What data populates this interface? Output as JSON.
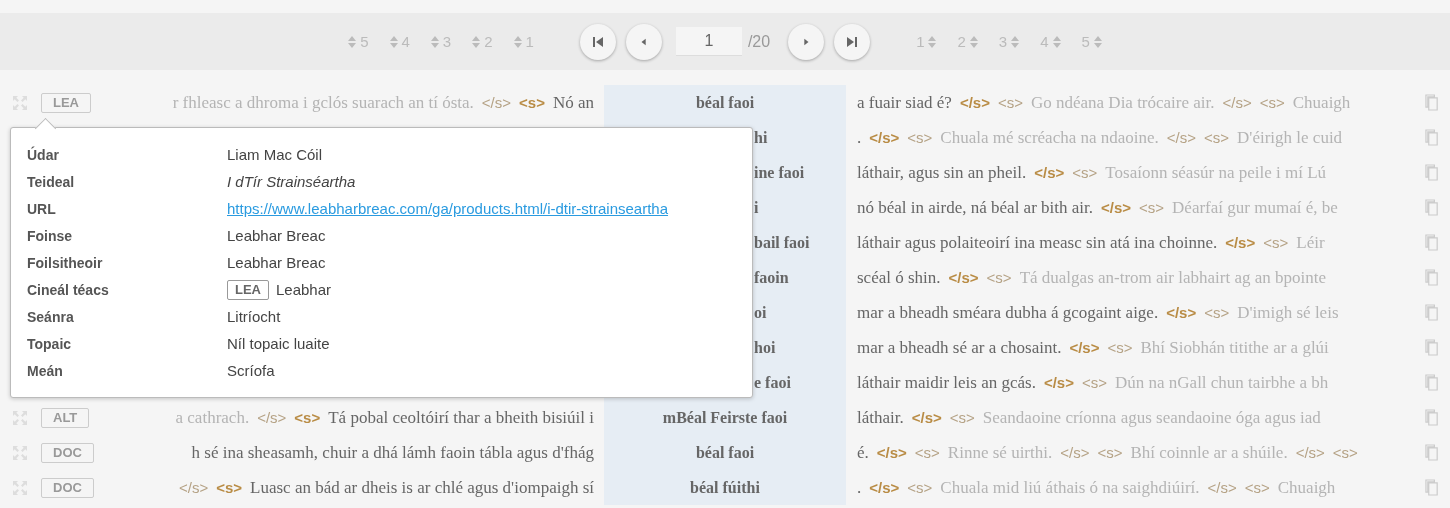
{
  "toolbar": {
    "left_sorts": [
      "5",
      "4",
      "3",
      "2",
      "1"
    ],
    "page_input": "1",
    "page_total": "/20",
    "right_sorts": [
      "1",
      "2",
      "3",
      "4",
      "5"
    ]
  },
  "rows": [
    {
      "badge": "LEA",
      "keyword": "béal faoi",
      "cut_off": false,
      "left": [
        {
          "kind": "text",
          "text": "r fhleasc a dhroma i gclós suarach an tí ósta.",
          "near": false
        },
        {
          "kind": "tag",
          "text": "</s>",
          "near": false
        },
        {
          "kind": "tag",
          "text": "<s>",
          "near": true
        },
        {
          "kind": "text",
          "text": "Nó an",
          "near": true
        }
      ],
      "right": [
        {
          "kind": "text",
          "text": "a fuair siad é?",
          "near": true
        },
        {
          "kind": "tag",
          "text": "</s>",
          "near": true
        },
        {
          "kind": "tag",
          "text": "<s>",
          "near": false
        },
        {
          "kind": "text",
          "text": "Go ndéana Dia trócaire air.",
          "near": false
        },
        {
          "kind": "tag",
          "text": "</s>",
          "near": false
        },
        {
          "kind": "tag",
          "text": "<s>",
          "near": false
        },
        {
          "kind": "text",
          "text": "Chuaigh",
          "near": false
        }
      ]
    },
    {
      "keyword": "hi",
      "cut_off": true,
      "right": [
        {
          "kind": "text",
          "text": ".",
          "near": true
        },
        {
          "kind": "tag",
          "text": "</s>",
          "near": true
        },
        {
          "kind": "tag",
          "text": "<s>",
          "near": false
        },
        {
          "kind": "text",
          "text": "Chuala mé scréacha na ndaoine.",
          "near": false
        },
        {
          "kind": "tag",
          "text": "</s>",
          "near": false
        },
        {
          "kind": "tag",
          "text": "<s>",
          "near": false
        },
        {
          "kind": "text",
          "text": "D'éirigh le cuid",
          "near": false
        }
      ]
    },
    {
      "keyword": "ine faoi",
      "cut_off": true,
      "right": [
        {
          "kind": "text",
          "text": "láthair, agus sin an pheil.",
          "near": true
        },
        {
          "kind": "tag",
          "text": "</s>",
          "near": true
        },
        {
          "kind": "tag",
          "text": "<s>",
          "near": false
        },
        {
          "kind": "text",
          "text": "Tosaíonn séasúr na peile i mí Lú",
          "near": false
        }
      ]
    },
    {
      "keyword": "i",
      "cut_off": true,
      "right": [
        {
          "kind": "text",
          "text": "nó béal in airde, ná béal ar bith air.",
          "near": true
        },
        {
          "kind": "tag",
          "text": "</s>",
          "near": true
        },
        {
          "kind": "tag",
          "text": "<s>",
          "near": false
        },
        {
          "kind": "text",
          "text": "Déarfaí gur mumaí é, be",
          "near": false
        }
      ]
    },
    {
      "keyword": "bail faoi",
      "cut_off": true,
      "right": [
        {
          "kind": "text",
          "text": "láthair agus polaiteoirí ina measc sin atá ina choinne.",
          "near": true
        },
        {
          "kind": "tag",
          "text": "</s>",
          "near": true
        },
        {
          "kind": "tag",
          "text": "<s>",
          "near": false
        },
        {
          "kind": "text",
          "text": "Léir",
          "near": false
        }
      ]
    },
    {
      "keyword": "faoin",
      "cut_off": true,
      "right": [
        {
          "kind": "text",
          "text": "scéal ó shin.",
          "near": true
        },
        {
          "kind": "tag",
          "text": "</s>",
          "near": true
        },
        {
          "kind": "tag",
          "text": "<s>",
          "near": false
        },
        {
          "kind": "text",
          "text": "Tá dualgas an-trom air labhairt ag an bpointe",
          "near": false
        }
      ]
    },
    {
      "keyword": "oi",
      "cut_off": true,
      "right": [
        {
          "kind": "text",
          "text": "mar a bheadh sméara dubha á gcogaint aige.",
          "near": true
        },
        {
          "kind": "tag",
          "text": "</s>",
          "near": true
        },
        {
          "kind": "tag",
          "text": "<s>",
          "near": false
        },
        {
          "kind": "text",
          "text": "D'imigh sé leis",
          "near": false
        }
      ]
    },
    {
      "keyword": "hoi",
      "cut_off": true,
      "right": [
        {
          "kind": "text",
          "text": "mar a bheadh sé ar a chosaint.",
          "near": true
        },
        {
          "kind": "tag",
          "text": "</s>",
          "near": true
        },
        {
          "kind": "tag",
          "text": "<s>",
          "near": false
        },
        {
          "kind": "text",
          "text": "Bhí Siobhán titithe ar a glúi",
          "near": false
        }
      ]
    },
    {
      "keyword": "e faoi",
      "cut_off": true,
      "right": [
        {
          "kind": "text",
          "text": "láthair maidir leis an gcás.",
          "near": true
        },
        {
          "kind": "tag",
          "text": "</s>",
          "near": true
        },
        {
          "kind": "tag",
          "text": "<s>",
          "near": false
        },
        {
          "kind": "text",
          "text": "Dún na nGall chun tairbhe a bh",
          "near": false
        }
      ]
    },
    {
      "badge": "ALT",
      "keyword": "mBéal Feirste faoi",
      "cut_off": false,
      "left": [
        {
          "kind": "text",
          "text": "a cathrach.",
          "near": false
        },
        {
          "kind": "tag",
          "text": "</s>",
          "near": false
        },
        {
          "kind": "tag",
          "text": "<s>",
          "near": true
        },
        {
          "kind": "text",
          "text": "Tá pobal ceoltóirí thar a bheith bisiúil i",
          "near": true
        }
      ],
      "right": [
        {
          "kind": "text",
          "text": "láthair.",
          "near": true
        },
        {
          "kind": "tag",
          "text": "</s>",
          "near": true
        },
        {
          "kind": "tag",
          "text": "<s>",
          "near": false
        },
        {
          "kind": "text",
          "text": "Seandaoine críonna agus seandaoine óga agus iad",
          "near": false
        }
      ]
    },
    {
      "badge": "DOC",
      "keyword": "béal faoi",
      "cut_off": false,
      "left": [
        {
          "kind": "text",
          "text": "h sé ina sheasamh, chuir a dhá lámh faoin tábla agus d'fhág",
          "near": true
        }
      ],
      "right": [
        {
          "kind": "text",
          "text": "é.",
          "near": true
        },
        {
          "kind": "tag",
          "text": "</s>",
          "near": true
        },
        {
          "kind": "tag",
          "text": "<s>",
          "near": false
        },
        {
          "kind": "text",
          "text": "Rinne sé uirthi.",
          "near": false
        },
        {
          "kind": "tag",
          "text": "</s>",
          "near": false
        },
        {
          "kind": "tag",
          "text": "<s>",
          "near": false
        },
        {
          "kind": "text",
          "text": "Bhí coinnle ar a shúile.",
          "near": false
        },
        {
          "kind": "tag",
          "text": "</s>",
          "near": false
        },
        {
          "kind": "tag",
          "text": "<s>",
          "near": false
        }
      ]
    },
    {
      "badge": "DOC",
      "keyword": "béal fúithi",
      "cut_off": false,
      "left": [
        {
          "kind": "tag",
          "text": "</s>",
          "near": false
        },
        {
          "kind": "tag",
          "text": "<s>",
          "near": true
        },
        {
          "kind": "text",
          "text": "Luasc an bád ar dheis is ar chlé agus d'iompaigh sí",
          "near": true
        }
      ],
      "right": [
        {
          "kind": "text",
          "text": ".",
          "near": true
        },
        {
          "kind": "tag",
          "text": "</s>",
          "near": true
        },
        {
          "kind": "tag",
          "text": "<s>",
          "near": false
        },
        {
          "kind": "text",
          "text": "Chuala mid liú áthais ó na saighdiúirí.",
          "near": false
        },
        {
          "kind": "tag",
          "text": "</s>",
          "near": false
        },
        {
          "kind": "tag",
          "text": "<s>",
          "near": false
        },
        {
          "kind": "text",
          "text": "Chuaigh",
          "near": false
        }
      ]
    }
  ],
  "popover": {
    "fields": [
      {
        "label": "Údar",
        "kind": "text",
        "value": "Liam Mac Cóil"
      },
      {
        "label": "Teideal",
        "kind": "italic",
        "value": "I dTír Strainséartha"
      },
      {
        "label": "URL",
        "kind": "link",
        "value": "https://www.leabharbreac.com/ga/products.html/i-dtir-strainseartha"
      },
      {
        "label": "Foinse",
        "kind": "text",
        "value": "Leabhar Breac"
      },
      {
        "label": "Foilsitheoir",
        "kind": "text",
        "value": "Leabhar Breac"
      },
      {
        "label": "Cineál téacs",
        "kind": "badge",
        "badge": "LEA",
        "value": "Leabhar"
      },
      {
        "label": "Seánra",
        "kind": "text",
        "value": "Litríocht"
      },
      {
        "label": "Topaic",
        "kind": "text",
        "value": "Níl topaic luaite"
      },
      {
        "label": "Meán",
        "kind": "text",
        "value": "Scríofa"
      }
    ]
  }
}
